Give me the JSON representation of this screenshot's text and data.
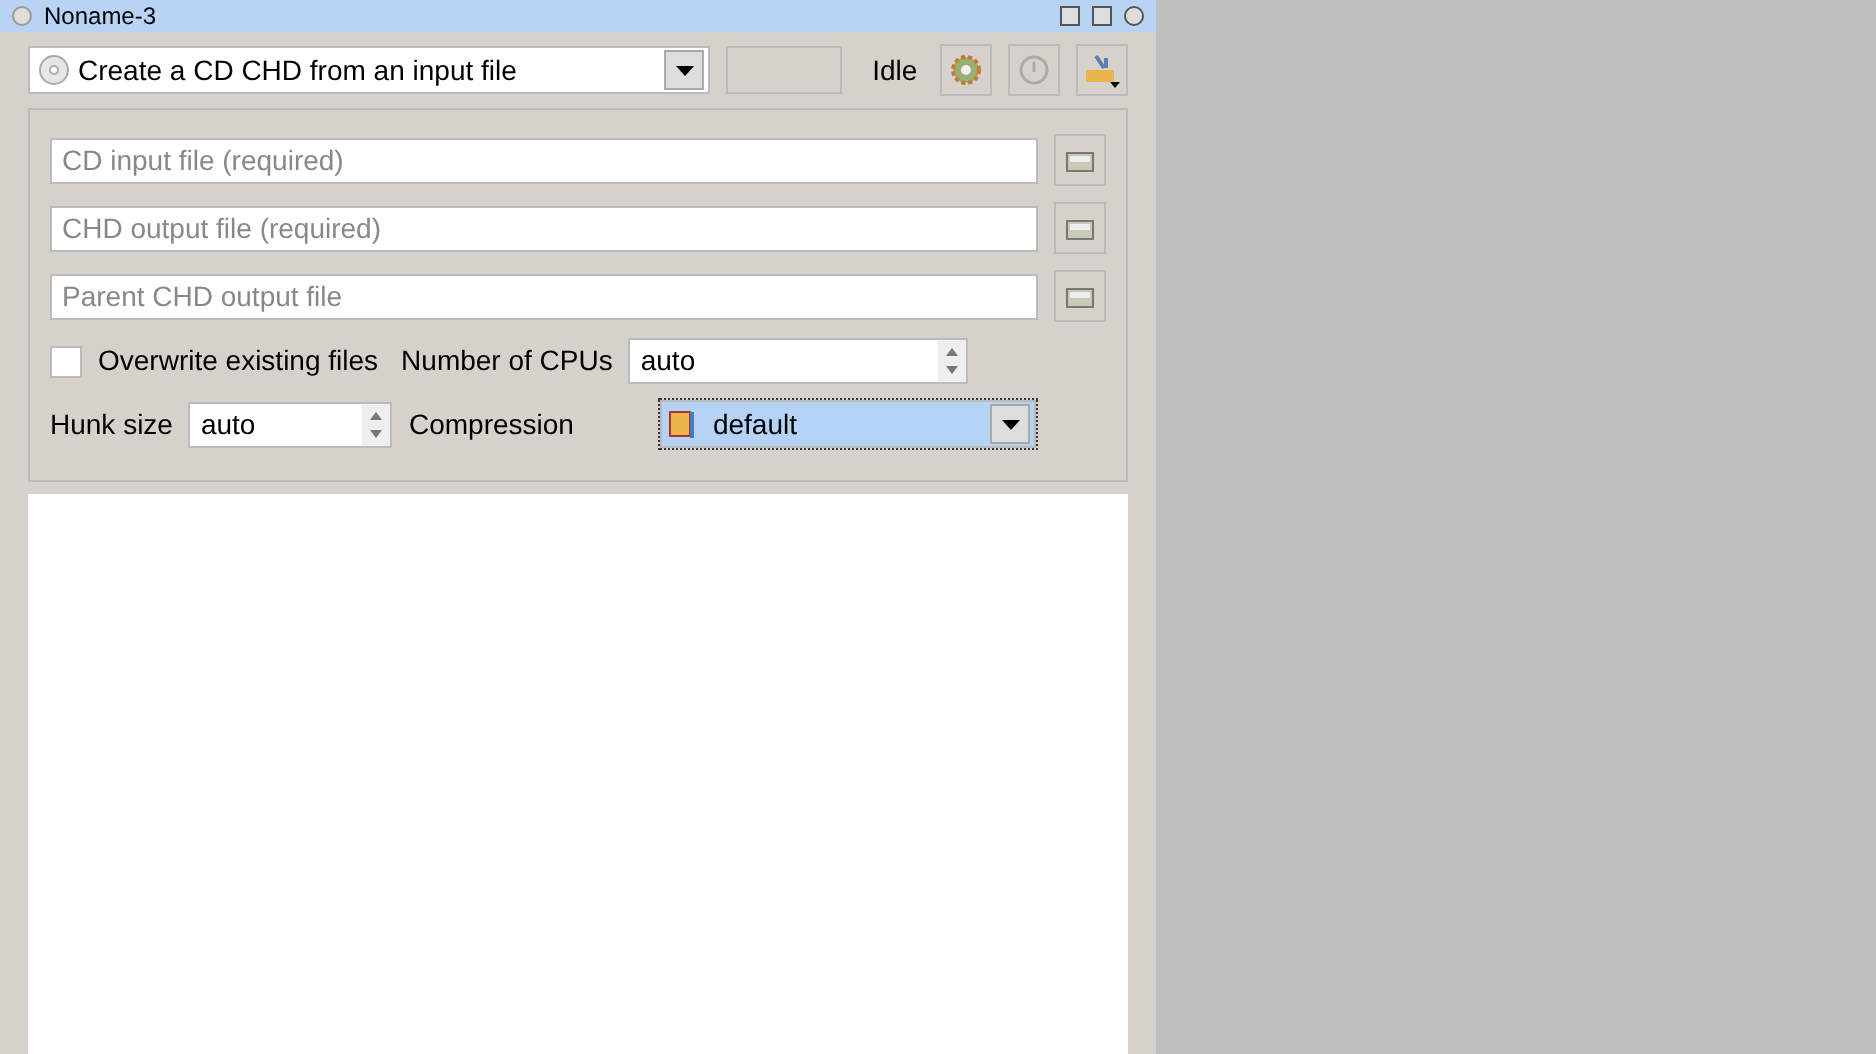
{
  "window": {
    "title": "Noname-3"
  },
  "toolbar": {
    "command": "Create a CD CHD from an input file",
    "status": "Idle"
  },
  "files": [
    {
      "placeholder": "CD input file (required)"
    },
    {
      "placeholder": "CHD output file (required)"
    },
    {
      "placeholder": "Parent CHD output file"
    }
  ],
  "overwrite": {
    "label": "Overwrite existing files",
    "checked": false
  },
  "cpus": {
    "label": "Number of CPUs",
    "value": "auto"
  },
  "hunk": {
    "label": "Hunk size",
    "value": "auto"
  },
  "compression": {
    "label": "Compression",
    "value": "default",
    "selected": true
  }
}
